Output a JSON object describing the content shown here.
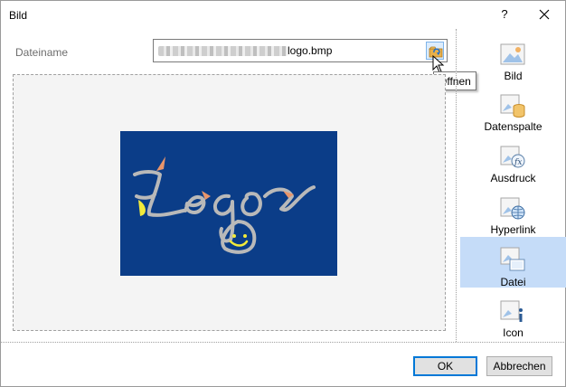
{
  "window": {
    "title": "Bild",
    "help_label": "?"
  },
  "file": {
    "label": "Dateiname",
    "value_suffix": "logo.bmp",
    "open_tooltip": "Öffnen"
  },
  "sidebar": {
    "items": [
      {
        "label": "Bild",
        "icon": "image-icon",
        "active": false
      },
      {
        "label": "Datenspalte",
        "icon": "data-column-icon",
        "active": false
      },
      {
        "label": "Ausdruck",
        "icon": "expression-icon",
        "active": false
      },
      {
        "label": "Hyperlink",
        "icon": "hyperlink-icon",
        "active": false
      },
      {
        "label": "Datei",
        "icon": "file-icon",
        "active": true
      },
      {
        "label": "Icon",
        "icon": "info-icon",
        "active": false
      }
    ]
  },
  "buttons": {
    "ok": "OK",
    "cancel": "Abbrechen"
  },
  "preview": {
    "image_alt": "Logo",
    "background": "#0b3d88"
  },
  "colors": {
    "accent": "#0078d7",
    "selection": "#c5dcf8"
  }
}
